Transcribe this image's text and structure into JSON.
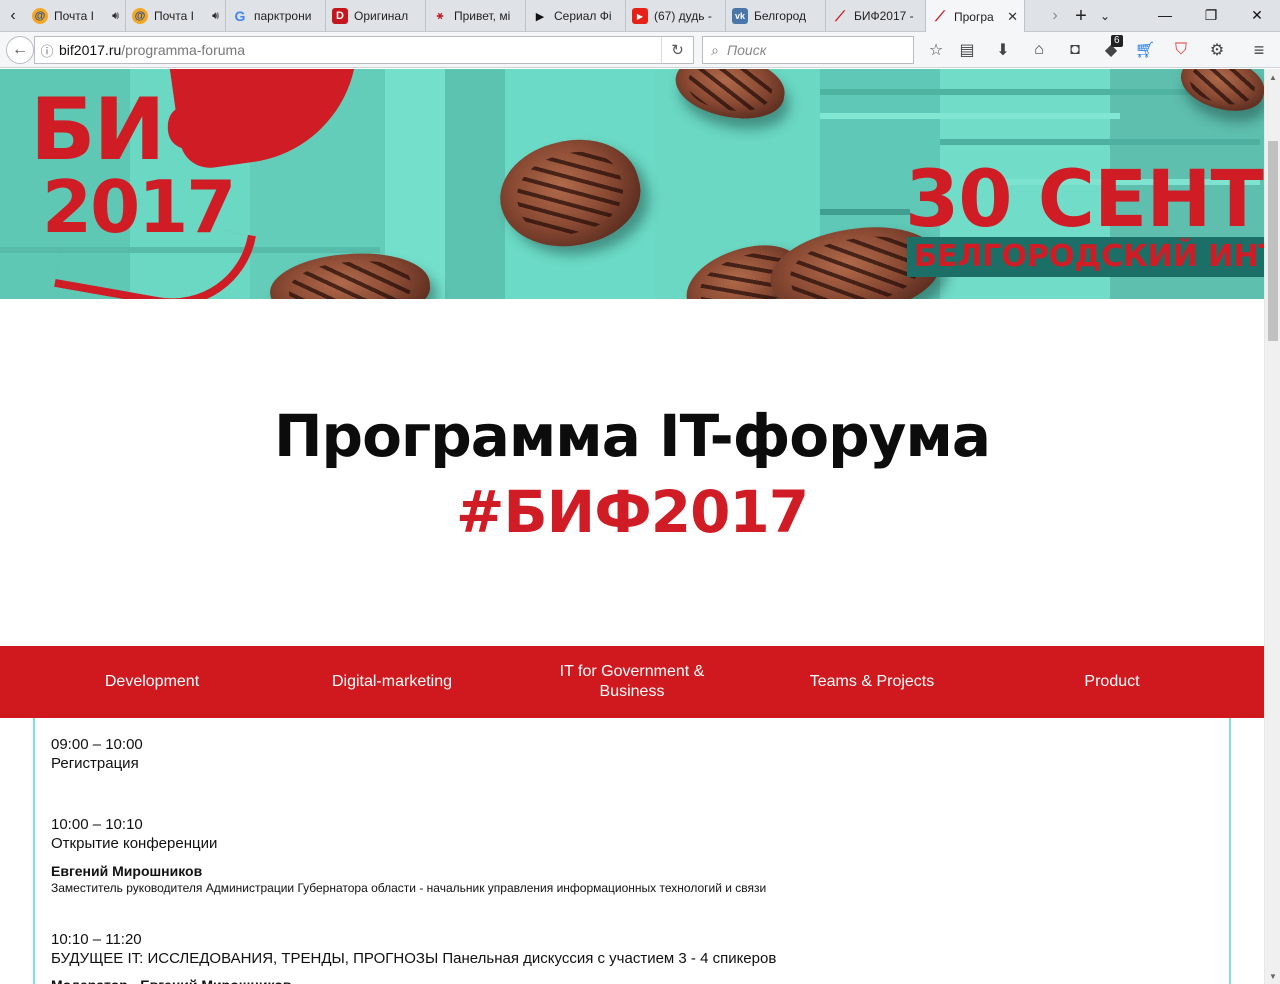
{
  "browser": {
    "tabs": [
      {
        "title": "Почта I",
        "icon": "mail-ru-icon",
        "audio": true
      },
      {
        "title": "Почта I",
        "icon": "mail-ru-icon",
        "audio": true
      },
      {
        "title": "парктрони",
        "icon": "google-icon"
      },
      {
        "title": "Оригинал",
        "icon": "d-icon"
      },
      {
        "title": "Привет, мі",
        "icon": "figure-icon"
      },
      {
        "title": "Сериал Фі",
        "icon": "play-icon"
      },
      {
        "title": "(67) дудь -",
        "icon": "youtube-icon"
      },
      {
        "title": "Белгород",
        "icon": "vk-icon"
      },
      {
        "title": "БИФ2017 -",
        "icon": "bif-icon"
      },
      {
        "title": "Програ",
        "icon": "bif-icon",
        "active": true
      }
    ],
    "url": {
      "host": "bif2017.ru",
      "path": "/programma-foruma"
    },
    "search_placeholder": "Поиск",
    "badge_count": "6",
    "accent_red": "#d0191f",
    "accent_teal": "#7fe3d4"
  },
  "banner": {
    "logo_line1": "БИФ",
    "logo_line2": "2017",
    "date_text": "30 СЕНТ",
    "subtitle": "БЕЛГОРОДСКИЙ ИНТ"
  },
  "heading": {
    "line1": "Программа IT-форума",
    "line2": "#БИФ2017"
  },
  "tracks": [
    "Development",
    "Digital-marketing",
    "IT for Government & Business",
    "Teams & Projects",
    "Product"
  ],
  "schedule": [
    {
      "time": "09:00 – 10:00",
      "title": "Регистрация"
    },
    {
      "time": "10:00 – 10:10",
      "title": "Открытие конференции",
      "speaker": "Евгений Мирошников",
      "role": "Заместитель руководителя Администрации Губернатора области - начальник управления информационных технологий и связи"
    },
    {
      "time": "10:10 – 11:20",
      "title": "БУДУЩЕЕ IT: ИССЛЕДОВАНИЯ, ТРЕНДЫ, ПРОГНОЗЫ Панельная дискуссия с участием 3 - 4 спикеров",
      "speaker": "Модератор - Евгений Мирошников"
    }
  ]
}
